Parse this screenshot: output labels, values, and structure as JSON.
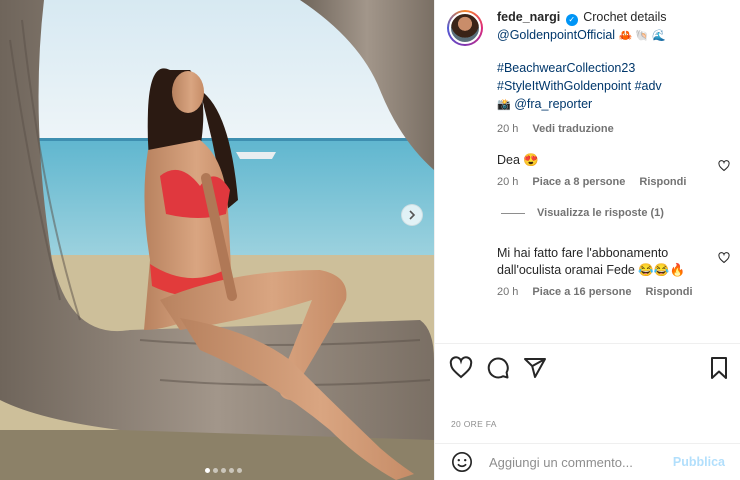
{
  "post": {
    "username": "fede_nargi",
    "caption_lines": [
      "Crochet details",
      "@GoldenpointOfficial",
      "#BeachwearCollection23",
      "#StyleItWithGoldenpoint #adv",
      "@fra_reporter"
    ],
    "caption_emojis": [
      "🦀 🐚 🌊",
      "📸"
    ],
    "time": "20 h",
    "translate_label": "Vedi traduzione"
  },
  "comments": [
    {
      "text": "Dea 😍",
      "time": "20 h",
      "likes": "Piace a 8 persone",
      "reply_label": "Rispondi",
      "view_replies": "Visualizza le risposte (1)"
    },
    {
      "text": "Mi hai fatto fare l'abbonamento dall'oculista oramai Fede 😂😂🔥",
      "time": "20 h",
      "likes": "Piace a 16 persone",
      "reply_label": "Rispondi"
    }
  ],
  "footer": {
    "timestamp": "20 ORE FA",
    "comment_placeholder": "Aggiungi un commento...",
    "publish_label": "Pubblica"
  },
  "carousel": {
    "slides": 5,
    "current": 1
  },
  "icons": [
    "heart-icon",
    "comment-icon",
    "share-icon",
    "bookmark-icon",
    "smile-icon",
    "chevron-right-icon",
    "verified-icon"
  ],
  "colors": {
    "verified": "#0095f6",
    "link": "#00376b",
    "publish_disabled": "#b2dffc",
    "secondary_text": "#737373"
  }
}
